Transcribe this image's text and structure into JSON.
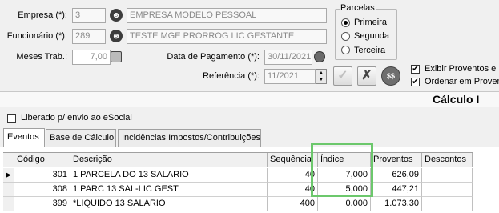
{
  "form": {
    "empresa": {
      "label": "Empresa (*):",
      "code": "3",
      "name": "EMPRESA MODELO PESSOAL"
    },
    "funcionario": {
      "label": "Funcionário (*):",
      "code": "289",
      "name": "TESTE MGE PRORROG LIC GESTANTE"
    },
    "meses_trab": {
      "label": "Meses Trab.:",
      "value": "7,00"
    },
    "data_pagamento": {
      "label": "Data de Pagamento (*):",
      "value": "30/11/2021"
    },
    "referencia": {
      "label": "Referência (*):",
      "value": "11/2021"
    }
  },
  "parcelas": {
    "title": "Parcelas",
    "options": [
      "Primeira",
      "Segunda",
      "Terceira"
    ],
    "selected": "Primeira"
  },
  "options": {
    "exibir": "Exibir Proventos e D",
    "ordenar": "Ordenar em Proven"
  },
  "buttons": {
    "confirm_icon": "✓",
    "cancel_icon": "✗",
    "calc_icon": "$$"
  },
  "header_title": "Cálculo I",
  "liberado": "Liberado p/ envio ao eSocial",
  "tabs": [
    "Eventos",
    "Base de Cálculo",
    "Incidências Impostos/Contribuições"
  ],
  "active_tab": "Eventos",
  "table": {
    "columns": [
      "Código",
      "Descrição",
      "Sequência",
      "Índice",
      "Proventos",
      "Descontos"
    ],
    "rows": [
      {
        "codigo": "301",
        "descricao": "1 PARCELA DO 13 SALARIO",
        "sequencia": "40",
        "indice": "7,000",
        "proventos": "626,09",
        "descontos": ""
      },
      {
        "codigo": "308",
        "descricao": "1 PARC 13 SAL-LIC GEST",
        "sequencia": "40",
        "indice": "5,000",
        "proventos": "447,21",
        "descontos": ""
      },
      {
        "codigo": "399",
        "descricao": "*LIQUIDO 13 SALARIO",
        "sequencia": "400",
        "indice": "0,000",
        "proventos": "1.073,30",
        "descontos": ""
      }
    ]
  },
  "colors": {
    "highlight": "#6cc86c"
  }
}
